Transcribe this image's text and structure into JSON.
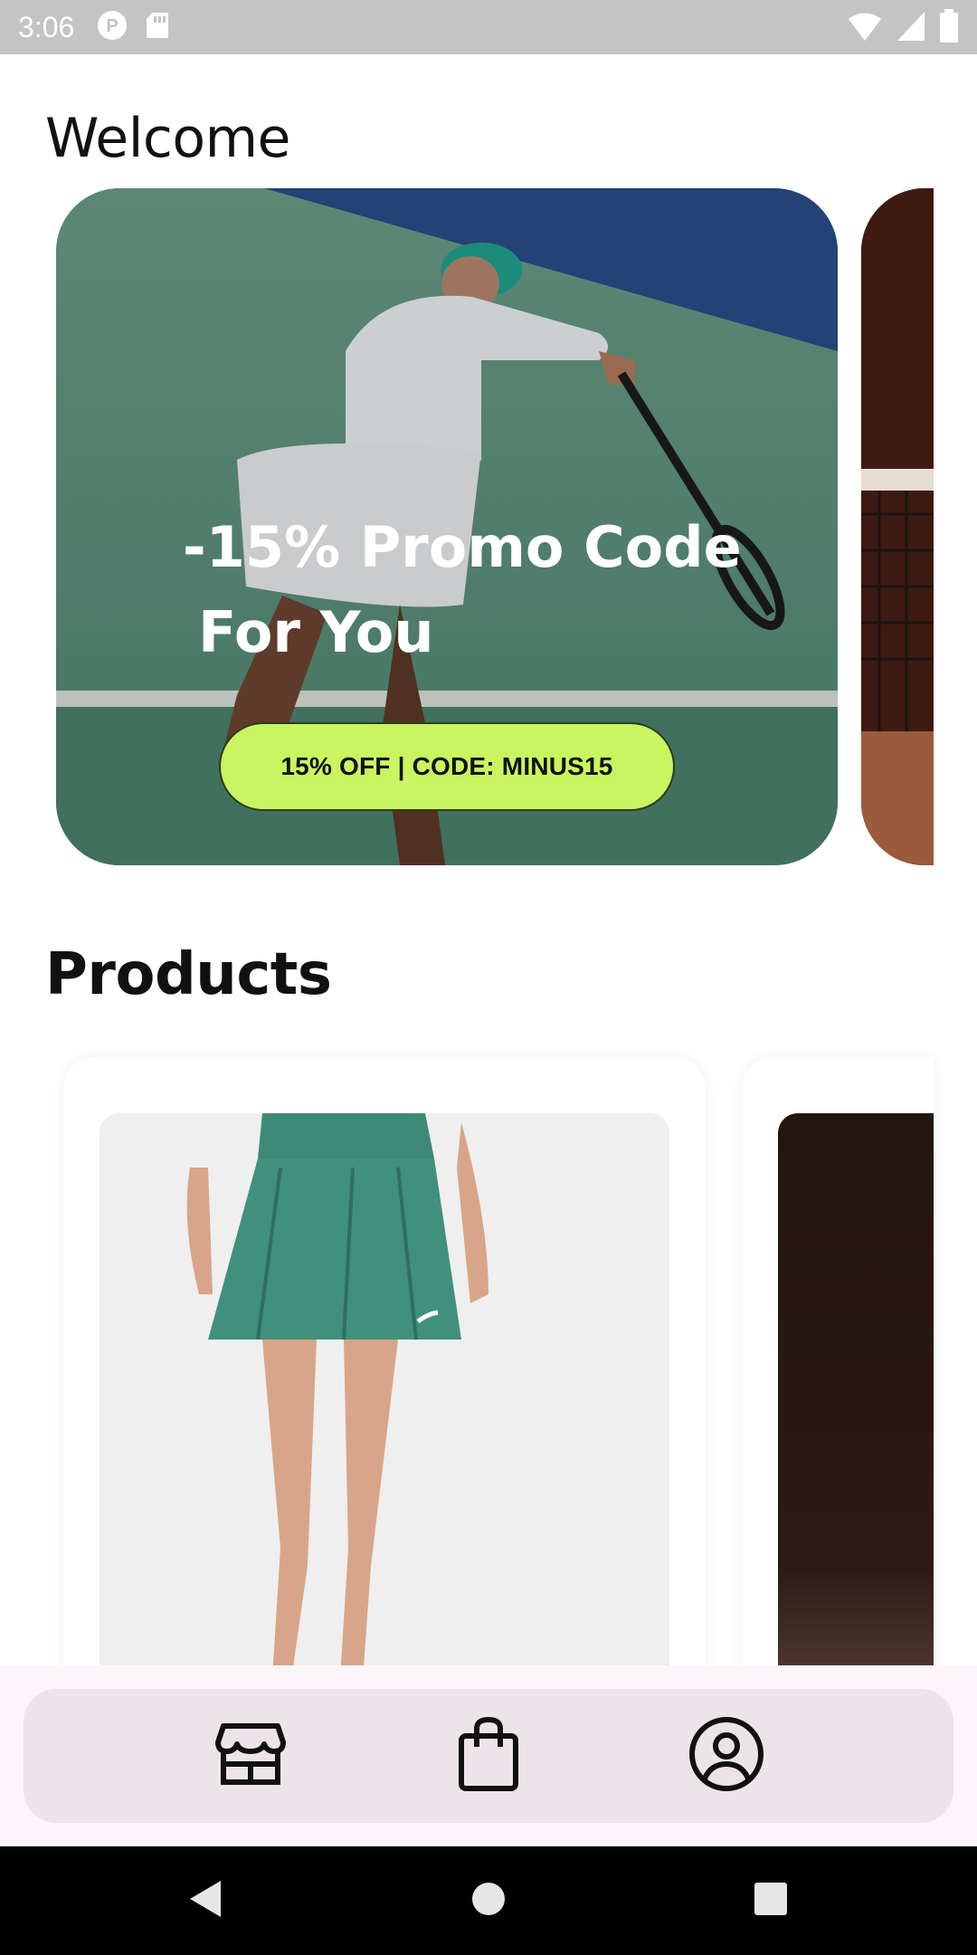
{
  "status_bar": {
    "time": "3:06",
    "icons": [
      "notification-p-icon",
      "sd-card-icon",
      "wifi-icon",
      "signal-icon",
      "battery-icon"
    ]
  },
  "header": {
    "title": "Welcome"
  },
  "promo": {
    "title_line1": "-15% Promo Code",
    "title_line2": "For You",
    "button_label": "15% OFF | CODE: MINUS15",
    "button_color": "#c9f560"
  },
  "products": {
    "title": "Products"
  },
  "bottom_nav": {
    "items": [
      {
        "icon": "store-icon"
      },
      {
        "icon": "shopping-bag-icon"
      },
      {
        "icon": "account-icon"
      }
    ]
  },
  "system_nav": {
    "icons": [
      "back-icon",
      "home-icon",
      "recents-icon"
    ]
  }
}
